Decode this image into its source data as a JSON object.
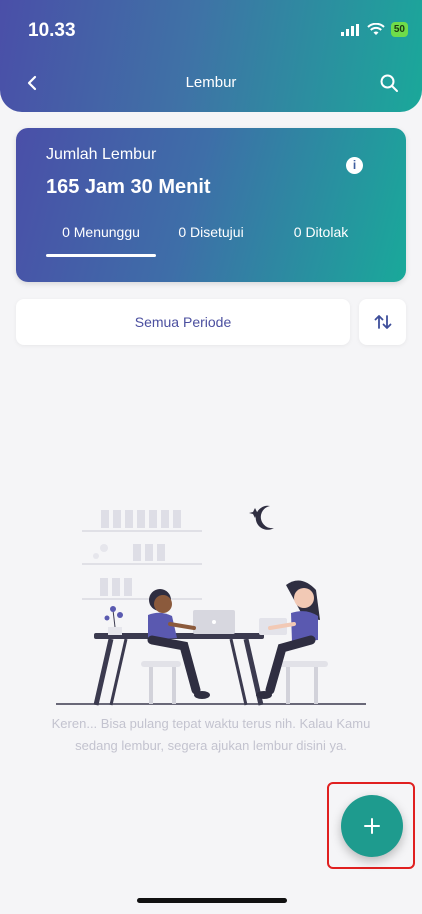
{
  "status_bar": {
    "time": "10.33",
    "battery": "50"
  },
  "nav": {
    "title": "Lembur"
  },
  "summary": {
    "label": "Jumlah Lembur",
    "value": "165 Jam 30 Menit",
    "tabs": [
      {
        "label": "0 Menunggu",
        "active": true
      },
      {
        "label": "0 Disetujui",
        "active": false
      },
      {
        "label": "0 Ditolak",
        "active": false
      }
    ]
  },
  "filter": {
    "period_label": "Semua Periode"
  },
  "empty_state": {
    "line1": "Keren... Bisa pulang tepat waktu terus nih. Kalau Kamu",
    "line2": "sedang lembur, segera ajukan lembur disini ya."
  },
  "colors": {
    "accent": "#1e9b8e",
    "primary": "#4a4fa8",
    "highlight": "#e02020"
  }
}
